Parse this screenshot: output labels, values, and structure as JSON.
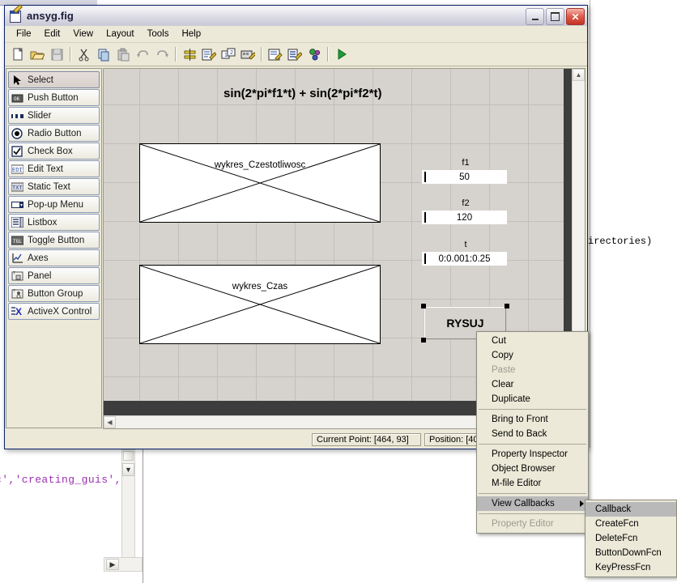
{
  "window": {
    "title": "ansyg.fig",
    "title_icon": "figure-file-icon",
    "minimize": "–",
    "maximize": "□",
    "close": "✕"
  },
  "menubar": {
    "items": [
      {
        "label": "File"
      },
      {
        "label": "Edit"
      },
      {
        "label": "View"
      },
      {
        "label": "Layout"
      },
      {
        "label": "Tools"
      },
      {
        "label": "Help"
      }
    ]
  },
  "toolbar": {
    "buttons": [
      {
        "name": "new-figure-icon",
        "label": "New"
      },
      {
        "name": "open-icon",
        "label": "Open"
      },
      {
        "name": "save-icon",
        "label": "Save",
        "disabled": true
      },
      {
        "name": "cut-icon",
        "label": "Cut"
      },
      {
        "name": "copy-icon",
        "label": "Copy"
      },
      {
        "name": "paste-icon",
        "label": "Paste",
        "disabled": true
      },
      {
        "name": "undo-icon",
        "label": "Undo",
        "disabled": true
      },
      {
        "name": "redo-icon",
        "label": "Redo",
        "disabled": true
      },
      {
        "name": "align-objects-icon",
        "label": "Align Objects"
      },
      {
        "name": "menu-editor-icon",
        "label": "Menu Editor"
      },
      {
        "name": "tab-order-editor-icon",
        "label": "Tab Order Editor"
      },
      {
        "name": "toolbar-editor-icon",
        "label": "Toolbar Editor"
      },
      {
        "name": "m-file-editor-icon",
        "label": "M-file Editor"
      },
      {
        "name": "property-inspector-icon",
        "label": "Property Inspector"
      },
      {
        "name": "object-browser-icon",
        "label": "Object Browser"
      },
      {
        "name": "run-icon",
        "label": "Run"
      }
    ]
  },
  "palette": {
    "items": [
      {
        "label": "Select",
        "icon": "arrow-cursor-icon",
        "selected": true
      },
      {
        "label": "Push Button",
        "icon": "push-button-icon",
        "selected": false
      },
      {
        "label": "Slider",
        "icon": "slider-icon",
        "selected": false
      },
      {
        "label": "Radio Button",
        "icon": "radio-button-icon",
        "selected": false
      },
      {
        "label": "Check Box",
        "icon": "check-box-icon",
        "selected": false
      },
      {
        "label": "Edit Text",
        "icon": "edit-text-icon",
        "selected": false
      },
      {
        "label": "Static Text",
        "icon": "static-text-icon",
        "selected": false
      },
      {
        "label": "Pop-up Menu",
        "icon": "popup-menu-icon",
        "selected": false
      },
      {
        "label": "Listbox",
        "icon": "listbox-icon",
        "selected": false
      },
      {
        "label": "Toggle Button",
        "icon": "toggle-button-icon",
        "selected": false
      },
      {
        "label": "Axes",
        "icon": "axes-icon",
        "selected": false
      },
      {
        "label": "Panel",
        "icon": "panel-icon",
        "selected": false
      },
      {
        "label": "Button Group",
        "icon": "button-group-icon",
        "selected": false
      },
      {
        "label": "ActiveX Control",
        "icon": "activex-icon",
        "selected": false
      }
    ]
  },
  "figure": {
    "title_text": "sin(2*pi*f1*t) + sin(2*pi*f2*t)",
    "axes": [
      {
        "tag": "wykres_Czestotliwosc"
      },
      {
        "tag": "wykres_Czas"
      }
    ],
    "labels": [
      {
        "text": "f1"
      },
      {
        "text": "f2"
      },
      {
        "text": "t"
      }
    ],
    "edits": [
      {
        "value": "50"
      },
      {
        "value": "120"
      },
      {
        "value": "0:0.001:0.25"
      }
    ],
    "push_button": {
      "label": "RYSUJ",
      "selected": true
    }
  },
  "statusbar": {
    "current_point_label": "Current Point:  [464, 93]",
    "position_label": "Position:  [400"
  },
  "context_menu": {
    "items": [
      {
        "label": "Cut",
        "state": "normal"
      },
      {
        "label": "Copy",
        "state": "normal"
      },
      {
        "label": "Paste",
        "state": "disabled"
      },
      {
        "label": "Clear",
        "state": "normal"
      },
      {
        "label": "Duplicate",
        "state": "normal"
      },
      {
        "label": "separator",
        "state": "separator"
      },
      {
        "label": "Bring to Front",
        "state": "normal"
      },
      {
        "label": "Send to Back",
        "state": "normal"
      },
      {
        "label": "separator",
        "state": "separator"
      },
      {
        "label": "Property Inspector",
        "state": "normal"
      },
      {
        "label": "Object Browser",
        "state": "normal"
      },
      {
        "label": "M-file Editor",
        "state": "normal"
      },
      {
        "label": "separator",
        "state": "separator"
      },
      {
        "label": "View Callbacks",
        "state": "highlight",
        "submenu": true
      },
      {
        "label": "separator",
        "state": "separator"
      },
      {
        "label": "Property Editor",
        "state": "disabled"
      }
    ],
    "submenu": {
      "items": [
        {
          "label": "Callback",
          "state": "highlight"
        },
        {
          "label": "CreateFcn",
          "state": "normal"
        },
        {
          "label": "DeleteFcn",
          "state": "normal"
        },
        {
          "label": "ButtonDownFcn",
          "state": "normal"
        },
        {
          "label": "KeyPressFcn",
          "state": "normal"
        }
      ]
    }
  },
  "background": {
    "code_right": "irectories)",
    "code_left": "c','creating_guis',"
  },
  "colors": {
    "titlebar_active": "#0a5fd4",
    "figure_background": "#d6d3ce",
    "window_face": "#ece9d8",
    "menu_highlight": "#b9b9b9",
    "comment_purple": "#9b30b0"
  }
}
